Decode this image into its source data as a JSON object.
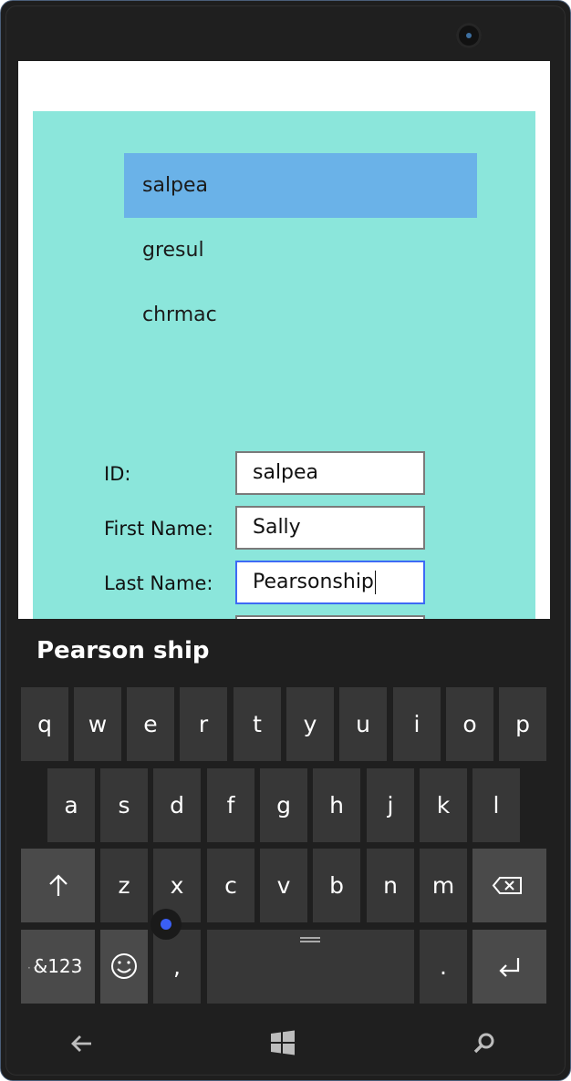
{
  "list": {
    "items": [
      {
        "label": "salpea",
        "selected": true
      },
      {
        "label": "gresul",
        "selected": false
      },
      {
        "label": "chrmac",
        "selected": false
      }
    ]
  },
  "form": {
    "id_label": "ID:",
    "id_value": "salpea",
    "first_name_label": "First Name:",
    "first_name_value": "Sally",
    "last_name_label": "Last Name:",
    "last_name_value": "Pearsonship"
  },
  "keyboard": {
    "suggestion": "Pearson ship",
    "row1": [
      "q",
      "w",
      "e",
      "r",
      "t",
      "y",
      "u",
      "i",
      "o",
      "p"
    ],
    "row2": [
      "a",
      "s",
      "d",
      "f",
      "g",
      "h",
      "j",
      "k",
      "l"
    ],
    "row3": [
      "z",
      "x",
      "c",
      "v",
      "b",
      "n",
      "m"
    ],
    "shift_icon": "shift-arrow-icon",
    "backspace_icon": "backspace-icon",
    "symbols_label": "&123",
    "emoji_icon": "smiley-icon",
    "comma_label": ",",
    "period_label": ".",
    "enter_icon": "enter-icon"
  },
  "navbar": {
    "back_icon": "back-arrow-icon",
    "windows_icon": "windows-logo-icon",
    "search_icon": "search-icon"
  },
  "colors": {
    "panel_bg": "#8be6db",
    "selected_item": "#6ab2e8",
    "focused_border": "#3d6af5",
    "keyboard_bg": "#1f1f1f",
    "key_bg": "#373737"
  }
}
